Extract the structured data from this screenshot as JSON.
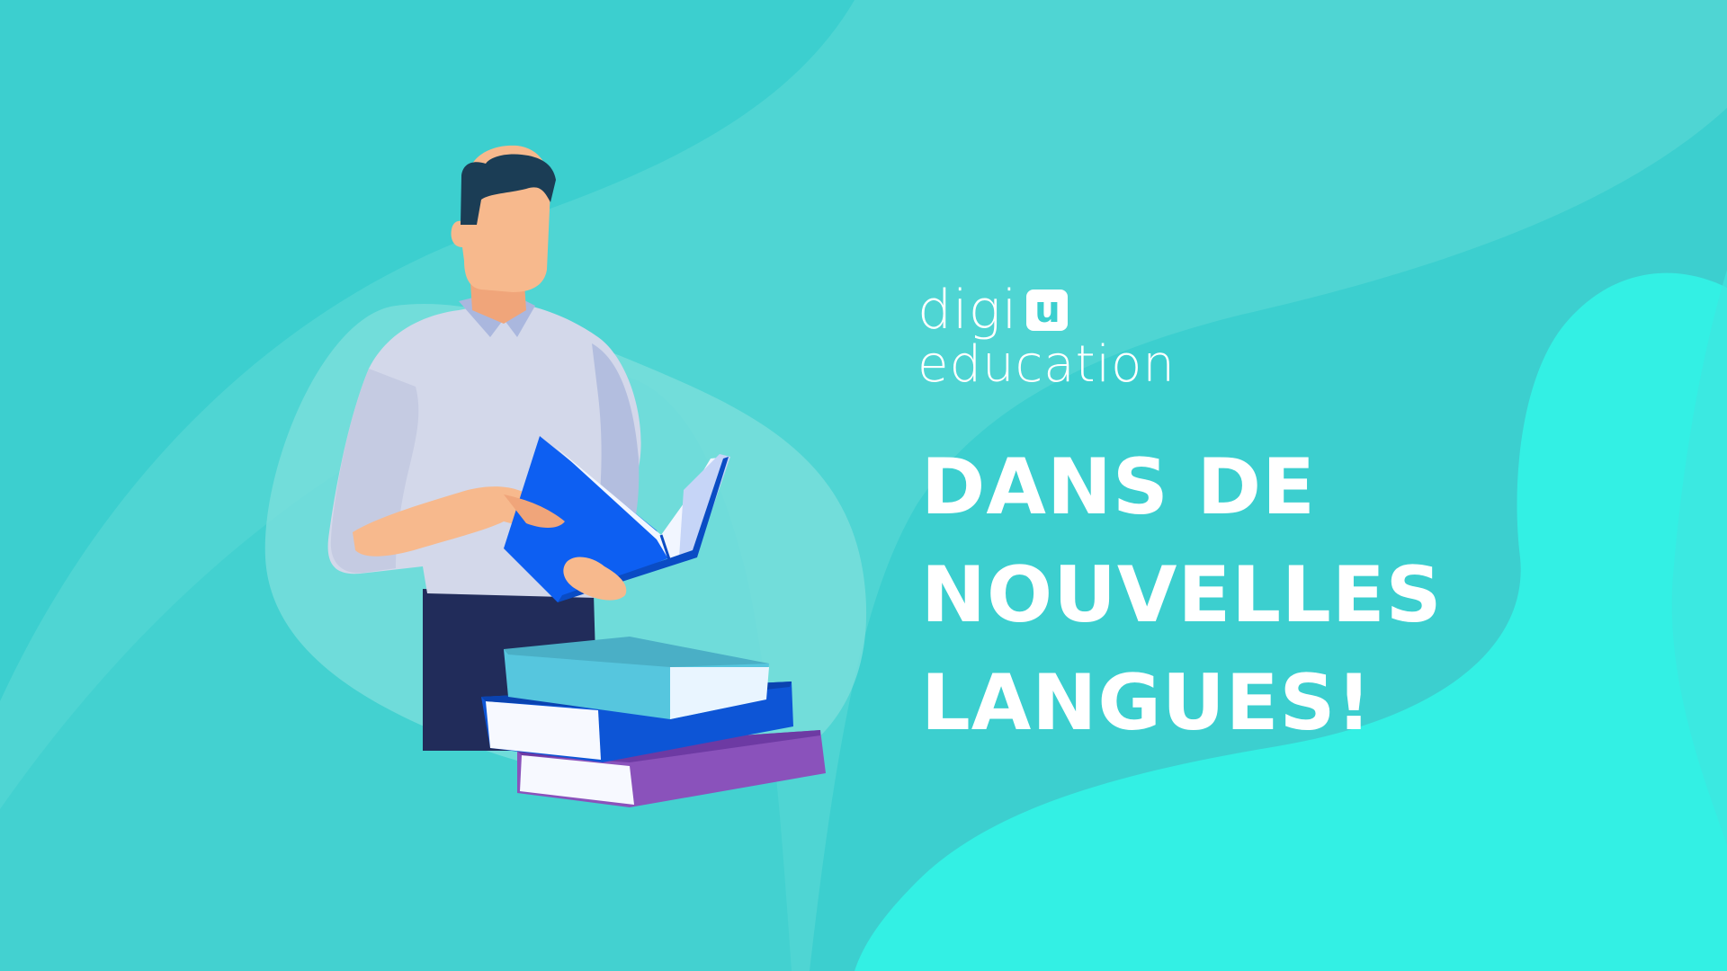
{
  "brand": {
    "word_top": "digi",
    "badge_letter": "u",
    "word_bottom": "education"
  },
  "headline": {
    "line1": "DANS DE",
    "line2": "NOUVELLES",
    "line3": "LANGUES!"
  },
  "colors": {
    "background": "#3ccfcf",
    "blob_light": "#5fdad7",
    "blob_bright": "#33f0e4",
    "text": "#ffffff",
    "book_blue": "#0d5ff2",
    "book_teal": "#56c6de",
    "book_purple": "#8a52bb",
    "shirt": "#d3d8ea",
    "pants": "#212c5a",
    "skin": "#f7b98d",
    "hair": "#1b3d55"
  },
  "illustration": {
    "subject": "man-reading-book-icon",
    "books": "stack-of-books-icon"
  }
}
